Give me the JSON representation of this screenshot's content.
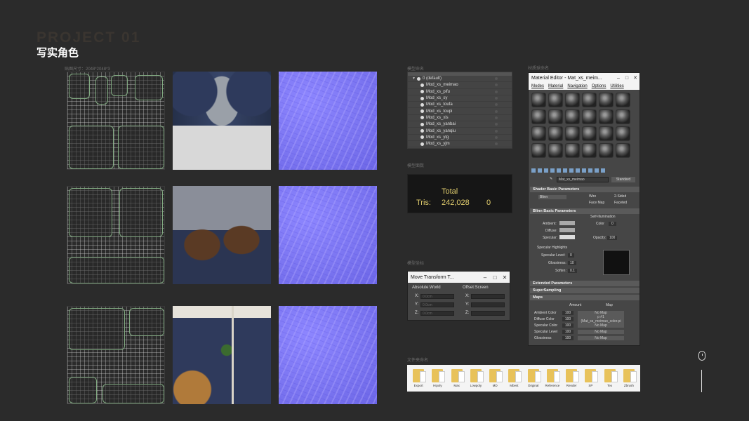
{
  "page": {
    "project_title": "PROJECT 01",
    "subtitle": "写实角色",
    "uv_caption": "贴图尺寸：2048*2048*3",
    "scene_caption": "模型命名",
    "stats_caption": "模型面数",
    "transform_caption": "模型坐标",
    "material_caption": "材质球命名",
    "folder_caption": "文件夹命名"
  },
  "scene_explorer": {
    "root": "0 (default)",
    "items": [
      "Mod_xs_meimao",
      "Mod_xs_pifu",
      "Mod_xs_sy",
      "Mod_xs_toufa",
      "Mod_xs_toupi",
      "Mod_xs_xis",
      "Mod_xs_yanbai",
      "Mod_xs_yanqiu",
      "Mod_xs_ytg",
      "Mod_xs_yjm"
    ]
  },
  "stats": {
    "total_label": "Total",
    "tris_label": "Tris:",
    "tris_value": "242,028",
    "tris_selected": "0"
  },
  "transform_dialog": {
    "title": "Move Transform T...",
    "absolute_label": "Absolute:World",
    "offset_label": "Offset:Screen",
    "fields": [
      "X:",
      "Y:",
      "Z:"
    ],
    "abs_values": [
      "0.0cm",
      "0.0cm",
      "0.0cm"
    ]
  },
  "material_editor": {
    "title": "Material Editor - Mat_xs_meim...",
    "menu": [
      "Modes",
      "Material",
      "Navigation",
      "Options",
      "Utilities"
    ],
    "material_name": "Mat_xs_meimao",
    "type_button": "Standard",
    "rollouts": {
      "shader_basic": "Shader Basic Parameters",
      "blinn_basic": "Blinn Basic Parameters",
      "extended": "Extended Parameters",
      "supersampling": "SuperSampling",
      "maps": "Maps"
    },
    "shader": "Blinn",
    "options": [
      "Wire",
      "2-Sided",
      "Face Map",
      "Faceted"
    ],
    "self_illum": "Self-Illumination",
    "color_label": "Color",
    "color_value": "0",
    "ambient": "Ambient:",
    "diffuse": "Diffuse:",
    "specular": "Specular:",
    "opacity_label": "Opacity:",
    "opacity_value": "100",
    "spec_highlights": "Specular Highlights",
    "spec_level": "Specular Level:",
    "spec_level_value": "0",
    "glossiness": "Glossiness:",
    "glossiness_value": "10",
    "soften": "Soften:",
    "soften_value": "0.1",
    "map_headers": [
      "Amount",
      "Map"
    ],
    "maps": [
      {
        "name": "Ambient Color",
        "amount": "100",
        "map": "No Map"
      },
      {
        "name": "Diffuse Color",
        "amount": "100",
        "map": "p #1 (Mat_xs_meimao_color.pi"
      },
      {
        "name": "Specular Color",
        "amount": "100",
        "map": "No Map"
      },
      {
        "name": "Specular Level",
        "amount": "100",
        "map": "No Map"
      },
      {
        "name": "Glossiness",
        "amount": "100",
        "map": "No Map"
      }
    ]
  },
  "folders": [
    "Export",
    "Hipoly",
    "Max",
    "Lowpoly",
    "MD",
    "Mbest",
    "Original",
    "Reference",
    "Render",
    "SP",
    "Tex",
    "Zbrush"
  ]
}
